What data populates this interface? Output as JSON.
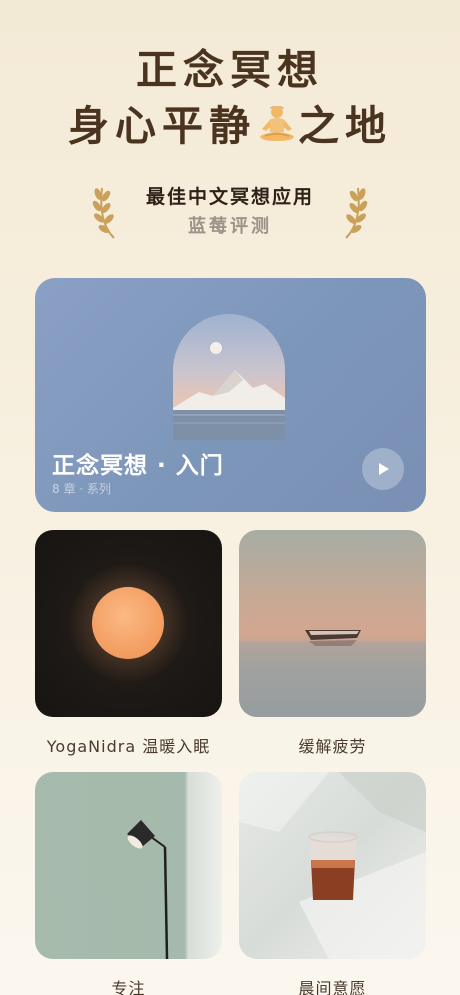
{
  "headline": {
    "line1": "正念冥想",
    "line2_before": "身心平静",
    "line2_after": "之地",
    "emoji": "meditating-person-icon"
  },
  "award": {
    "title": "最佳中文冥想应用",
    "subtitle": "蓝莓评测",
    "icon": "laurel-icon"
  },
  "hero": {
    "title": "正念冥想 · 入门",
    "meta": "8 章 · 系列",
    "play_icon": "play-icon"
  },
  "cards": [
    {
      "label": "YogaNidra 温暖入眠"
    },
    {
      "label": "缓解疲劳"
    },
    {
      "label": "专注"
    },
    {
      "label": "晨间意愿"
    }
  ],
  "colors": {
    "headline": "#4a331f",
    "hero_bg": "#7c96ba",
    "laurel": "#c9a15a"
  }
}
